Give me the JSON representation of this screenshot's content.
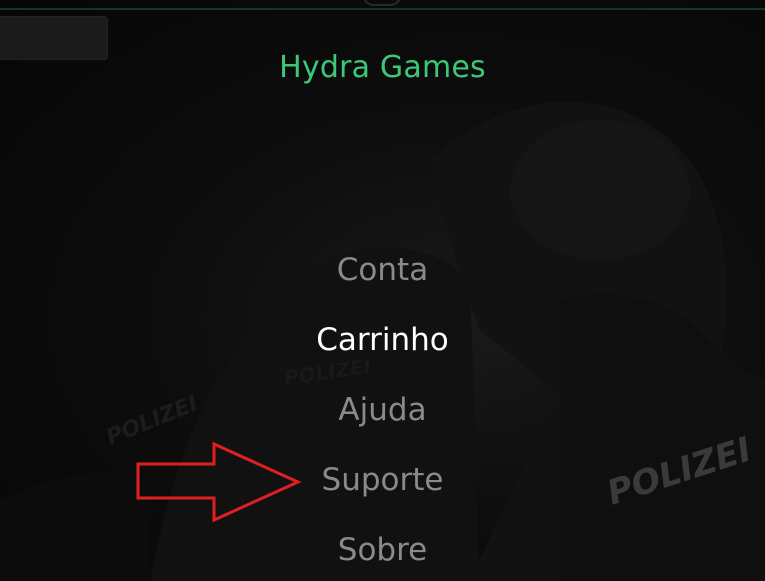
{
  "app": {
    "title": "Hydra Games",
    "accent_color": "#3cc878"
  },
  "search": {
    "placeholder": ""
  },
  "menu": {
    "items": [
      {
        "label": "Conta",
        "state": "normal"
      },
      {
        "label": "Carrinho",
        "state": "active"
      },
      {
        "label": "Ajuda",
        "state": "normal"
      },
      {
        "label": "Suporte",
        "state": "normal"
      },
      {
        "label": "Sobre",
        "state": "normal"
      }
    ],
    "normal_color": "#8a8a8a",
    "active_color": "#ffffff"
  },
  "background": {
    "overlay_texts": [
      "POLIZEI",
      "POLIZEI",
      "POLIZEI"
    ]
  },
  "annotation": {
    "icon": "arrow-right-icon",
    "color": "#e02020"
  }
}
